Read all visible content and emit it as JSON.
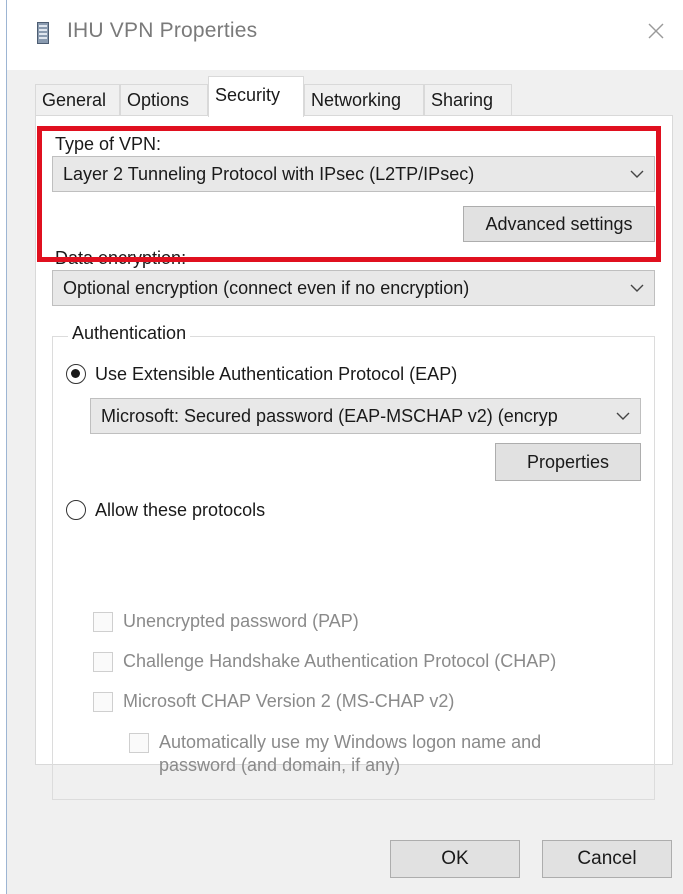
{
  "window": {
    "title": "IHU VPN Properties"
  },
  "tabs": [
    {
      "label": "General"
    },
    {
      "label": "Options"
    },
    {
      "label": "Security"
    },
    {
      "label": "Networking"
    },
    {
      "label": "Sharing"
    }
  ],
  "active_tab": "Security",
  "vpn_type": {
    "label": "Type of VPN:",
    "value": "Layer 2 Tunneling Protocol with IPsec (L2TP/IPsec)"
  },
  "advanced_settings_label": "Advanced settings",
  "data_encryption": {
    "label": "Data encryption:",
    "value": "Optional encryption (connect even if no encryption)"
  },
  "authentication": {
    "group_title": "Authentication",
    "eap_radio_label": "Use Extensible Authentication Protocol (EAP)",
    "eap_selected": true,
    "eap_method_value": "Microsoft: Secured password (EAP-MSCHAP v2) (encryp",
    "properties_label": "Properties",
    "allow_protocols_label": "Allow these protocols",
    "protocols": [
      {
        "label": "Unencrypted password (PAP)",
        "checked": false,
        "enabled": false
      },
      {
        "label": "Challenge Handshake Authentication Protocol (CHAP)",
        "checked": false,
        "enabled": false
      },
      {
        "label": "Microsoft CHAP Version 2 (MS-CHAP v2)",
        "checked": false,
        "enabled": false
      }
    ],
    "auto_logon_label_line1": "Automatically use my Windows logon name and",
    "auto_logon_label_line2": "password (and domain, if any)"
  },
  "footer": {
    "ok_label": "OK",
    "cancel_label": "Cancel"
  },
  "colors": {
    "highlight": "#e0101f",
    "dialog_bg": "#f0f0f0",
    "button_bg": "#e1e1e1"
  },
  "icons": [
    "vpn-connection-icon",
    "close-icon",
    "chevron-down-icon"
  ]
}
